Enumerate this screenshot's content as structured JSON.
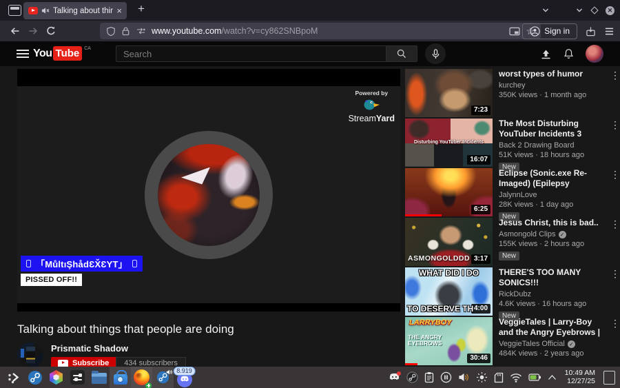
{
  "colors": {
    "overlay_blue": "#1c12f2",
    "subscribe_red": "#cc0000",
    "progress_red": "#ff0000",
    "yt_logo_red": "#e62117",
    "firefox_badge_green": "#2fae4a"
  },
  "browser": {
    "tab_title": "Talking about things",
    "url_host": "www.youtube.com",
    "url_path": "/watch?v=cy862SNBpoM",
    "sign_in": "Sign in"
  },
  "yt": {
    "logo_you": "You",
    "logo_tube": "Tube",
    "region": "CA",
    "search_placeholder": "Search"
  },
  "player": {
    "powered_by": "Powered by",
    "brand_stream": "Stream",
    "brand_yard": "Yard",
    "overlay_name": "「MůltıŞhådƐX̌ƐYT」",
    "overlay_caption": "PISSED OFF!!"
  },
  "video": {
    "title": "Talking about things that people are doing",
    "channel": "Prismatic Shadow",
    "subscribe": "Subscribe",
    "subscriber_count": "434 subscribers"
  },
  "recommended": [
    {
      "title": "worst types of humor",
      "channel": "kurchey",
      "meta": "350K views · 1 month ago",
      "duration": "7:23"
    },
    {
      "title": "The Most Disturbing YouTuber Incidents 3",
      "channel": "Back 2 Drawing Board",
      "meta": "51K views · 18 hours ago",
      "duration": "16:07",
      "badge": "New",
      "thumb_text1": "Disturbing YouTuber Incidents"
    },
    {
      "title": "Eclipse (Sonic.exe Re-Imaged) (Epilepsy Warning)",
      "channel": "JalynnLove",
      "meta": "28K views · 1 day ago",
      "duration": "6:25",
      "badge": "New",
      "progress_pct": 42
    },
    {
      "title": "Jesus Christ, this is bad..",
      "channel": "Asmongold Clips",
      "verified": true,
      "meta": "155K views · 2 hours ago",
      "duration": "3:17",
      "badge": "New",
      "thumb_text2": "ASMONGOLDDD"
    },
    {
      "title": "THERE'S TOO MANY SONICS!!!",
      "channel": "RickDubz",
      "meta": "4.6K views · 16 hours ago",
      "duration": "4:00",
      "badge": "New",
      "thumb_text1": "WHAT DID I DO",
      "thumb_text2": "TO DESERVE TH"
    },
    {
      "title": "VeggieTales | Larry-Boy and the Angry Eyebrows | A Lesson in …",
      "channel": "VeggieTales Official",
      "verified": true,
      "meta": "484K views · 2 years ago",
      "duration": "30:46",
      "thumb_text1": "LARRYBOY",
      "thumb_text2": "THE ANGRY EYEBROWS",
      "progress_pct": 14
    }
  ],
  "taskbar": {
    "counter_badge": "8.919",
    "clock_time": "10:49 AM",
    "clock_date": "12/27/25"
  }
}
